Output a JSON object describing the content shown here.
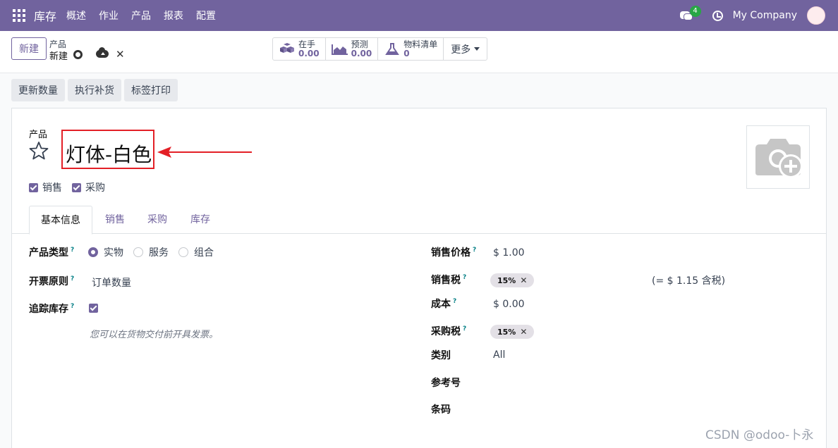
{
  "navbar": {
    "app_title": "库存",
    "menu": [
      "概述",
      "作业",
      "产品",
      "报表",
      "配置"
    ],
    "message_count": "4",
    "company": "My Company"
  },
  "control": {
    "new_label": "新建",
    "breadcrumb_parent": "产品",
    "breadcrumb_current": "新建",
    "stats": [
      {
        "label": "在手",
        "value": "0.00",
        "icon": "boxes-icon"
      },
      {
        "label": "预测",
        "value": "0.00",
        "icon": "area-chart-icon"
      },
      {
        "label": "物料清单",
        "value": "0",
        "icon": "flask-icon"
      }
    ],
    "more_label": "更多"
  },
  "actions": [
    "更新数量",
    "执行补货",
    "标签打印"
  ],
  "form": {
    "product_label": "产品",
    "product_name": "灯体-白色",
    "checkbox_sale": "销售",
    "checkbox_purchase": "采购",
    "tabs": [
      "基本信息",
      "销售",
      "采购",
      "库存"
    ],
    "left": {
      "product_type_label": "产品类型",
      "product_type_options": [
        "实物",
        "服务",
        "组合"
      ],
      "invoice_policy_label": "开票原则",
      "invoice_policy_value": "订单数量",
      "track_inventory_label": "追踪库存",
      "hint": "您可以在货物交付前开具发票。"
    },
    "right": {
      "sales_price_label": "销售价格",
      "sales_price_value": "$ 1.00",
      "sales_tax_label": "销售税",
      "sales_tax_value": "15%",
      "tax_included": "(= $ 1.15 含税)",
      "cost_label": "成本",
      "cost_value": "$ 0.00",
      "purchase_tax_label": "采购税",
      "purchase_tax_value": "15%",
      "category_label": "类别",
      "category_value": "All",
      "reference_label": "参考号",
      "barcode_label": "条码"
    }
  },
  "watermark": "CSDN @odoo-卜永",
  "colors": {
    "brand": "#71639e",
    "annotation": "#e31f26"
  }
}
